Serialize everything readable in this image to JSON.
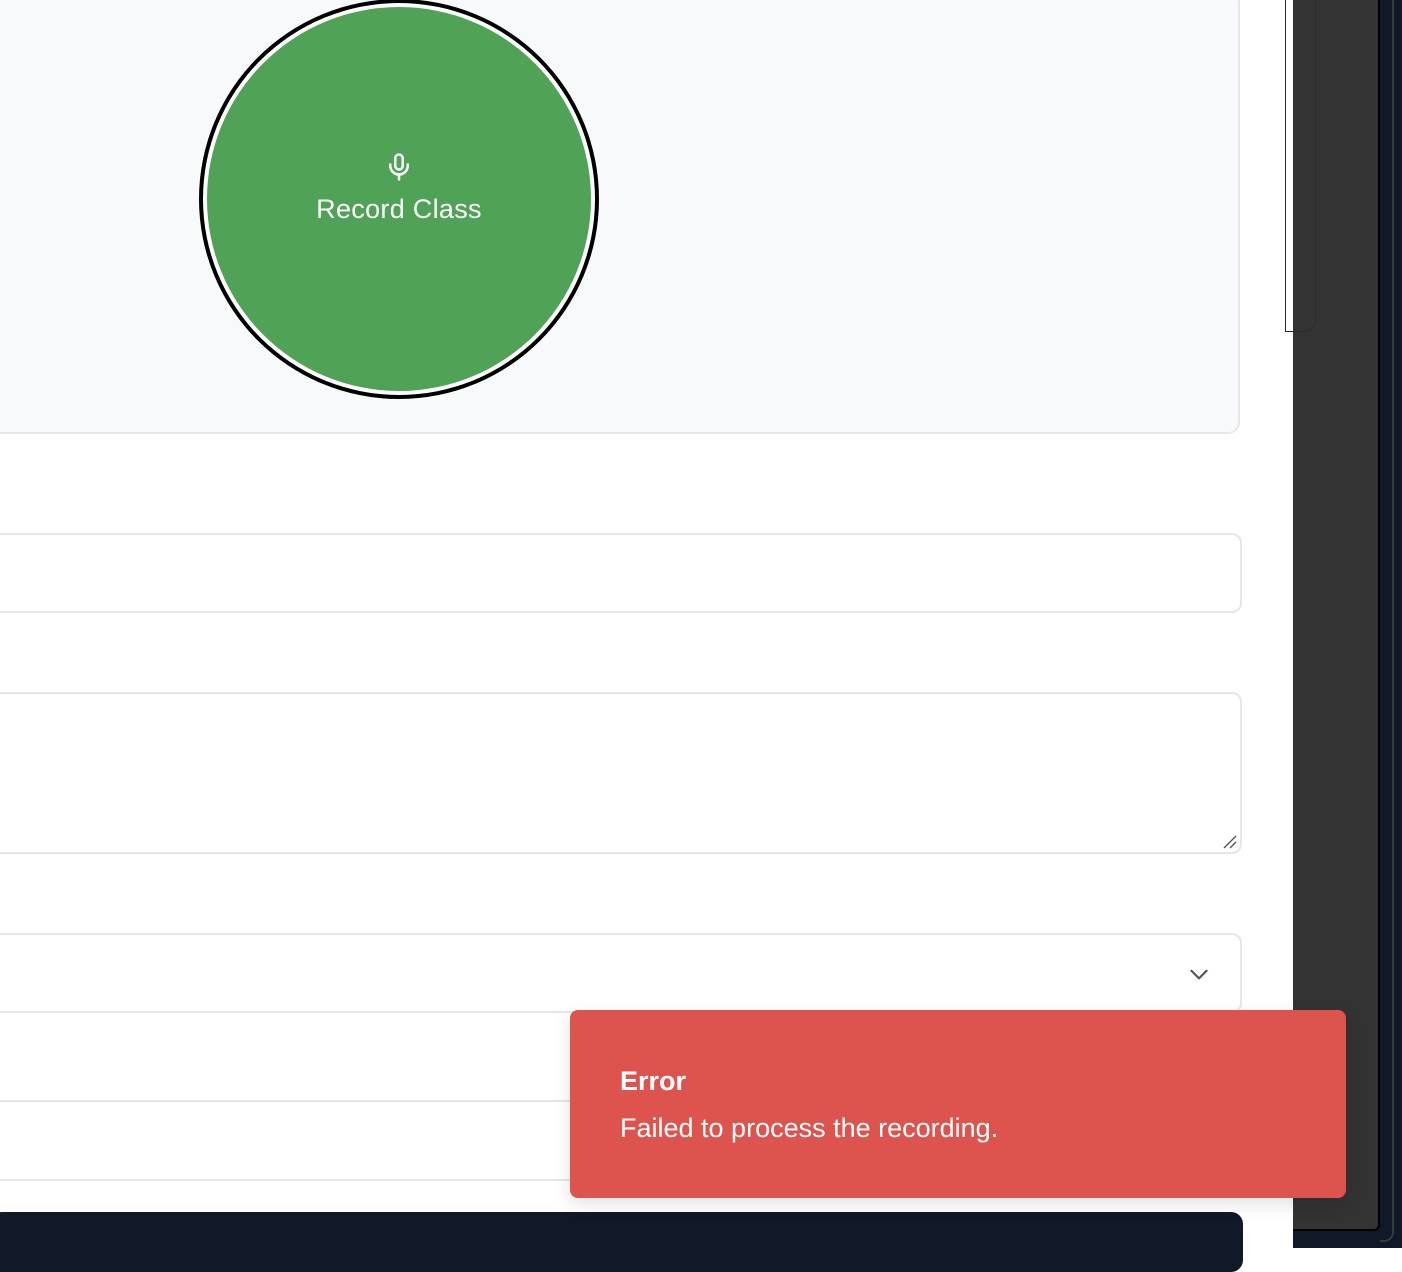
{
  "recorder": {
    "button_label": "Record Class",
    "button_icon": "microphone-icon",
    "button_color": "#50a257"
  },
  "form": {
    "input_value": "",
    "textarea_value": "",
    "select_value": "",
    "select_icon": "chevron-down-icon"
  },
  "toast": {
    "title": "Error",
    "message": "Failed to process the recording.",
    "color": "#dd544e"
  },
  "side_panel": {
    "color": "#333333"
  }
}
